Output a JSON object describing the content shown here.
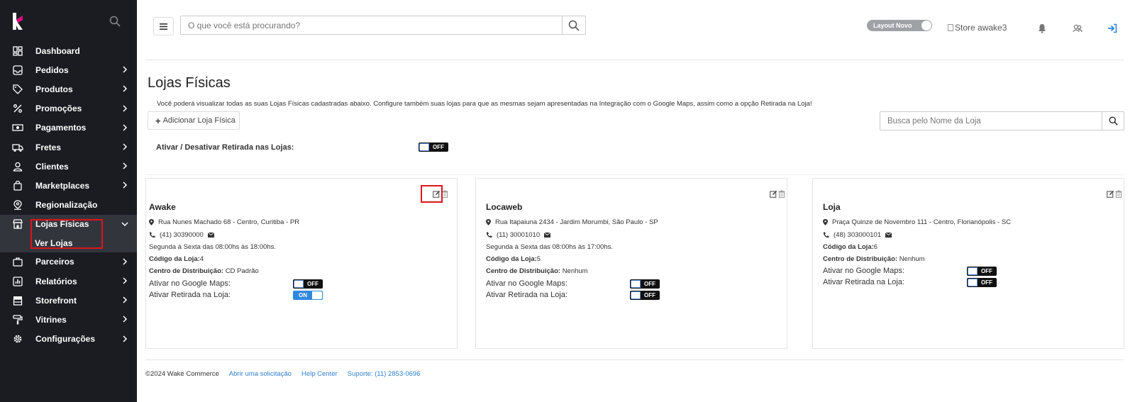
{
  "sidebar": {
    "items": [
      {
        "label": "Dashboard",
        "icon": "dashboard-icon"
      },
      {
        "label": "Pedidos",
        "icon": "inbox-icon"
      },
      {
        "label": "Produtos",
        "icon": "tag-icon"
      },
      {
        "label": "Promoções",
        "icon": "percent-icon"
      },
      {
        "label": "Pagamentos",
        "icon": "money-icon"
      },
      {
        "label": "Fretes",
        "icon": "truck-icon"
      },
      {
        "label": "Clientes",
        "icon": "user-icon"
      },
      {
        "label": "Marketplaces",
        "icon": "shopping-bag-icon"
      },
      {
        "label": "Regionalização",
        "icon": "location-icon"
      },
      {
        "label": "Lojas Físicas",
        "icon": "store-icon"
      },
      {
        "label": "Parceiros",
        "icon": "briefcase-icon"
      },
      {
        "label": "Relatórios",
        "icon": "chart-icon"
      },
      {
        "label": "Storefront",
        "icon": "storefront-icon"
      },
      {
        "label": "Vitrines",
        "icon": "paint-roller-icon"
      },
      {
        "label": "Configurações",
        "icon": "gear-icon"
      }
    ],
    "sub_item": "Ver Lojas"
  },
  "topbar": {
    "search_placeholder": "O que você está procurando?",
    "layout_toggle": "Layout Novo",
    "store_image_alt": "Store awake3"
  },
  "page": {
    "title": "Lojas Físicas",
    "description": "Você poderá visualizar todas as suas Lojas Físicas cadastradas abaixo. Configure também suas lojas para que as mesmas sejam apresentadas na Integração com o Google Maps, assim como a opção Retirada na Loja!",
    "add_button": "Adicionar Loja Física",
    "store_search_placeholder": "Busca pelo Nome da Loja",
    "global_toggle_label": "Ativar / Desativar Retirada nas Lojas:",
    "global_toggle_state": "OFF"
  },
  "labels": {
    "code": "Código da Loja:",
    "dc": "Centro de Distribuição:",
    "google_maps": "Ativar no Google Maps:",
    "pickup": "Ativar Retirada na Loja:"
  },
  "stores": [
    {
      "name": "Awake",
      "address": "Rua Nunes Machado 68 - Centro, Curitiba - PR",
      "phone": "(41) 30390000",
      "hours": "Segunda à Sexta das 08:00hs às 18:00hs.",
      "code": "4",
      "dc": "CD Padrão",
      "google_maps": "OFF",
      "pickup": "ON"
    },
    {
      "name": "Locaweb",
      "address": "Rua Itapaiuna 2434 - Jardim Morumbi, São Paulo - SP",
      "phone": "(11) 30001010",
      "hours": "Segunda à Sexta das 08:00hs às 17:00hs.",
      "code": "5",
      "dc": "Nenhum",
      "google_maps": "OFF",
      "pickup": "OFF"
    },
    {
      "name": "Loja",
      "address": "Praça Quinze de Novembro 111 - Centro, Florianópolis - SC",
      "phone": "(48) 303000101",
      "hours": "",
      "code": "6",
      "dc": "Nenhum",
      "google_maps": "OFF",
      "pickup": "OFF"
    }
  ],
  "footer": {
    "copyright": "©2024 Wake Commerce",
    "link1": "Abrir uma solicitação",
    "link2": "Help Center",
    "link3": "Suporte: (11) 2853-0696"
  },
  "colors": {
    "sidebar_bg": "#1b1c22",
    "active_bg": "#33353d",
    "highlight": "#e0141c",
    "accent": "#2f88e0"
  }
}
